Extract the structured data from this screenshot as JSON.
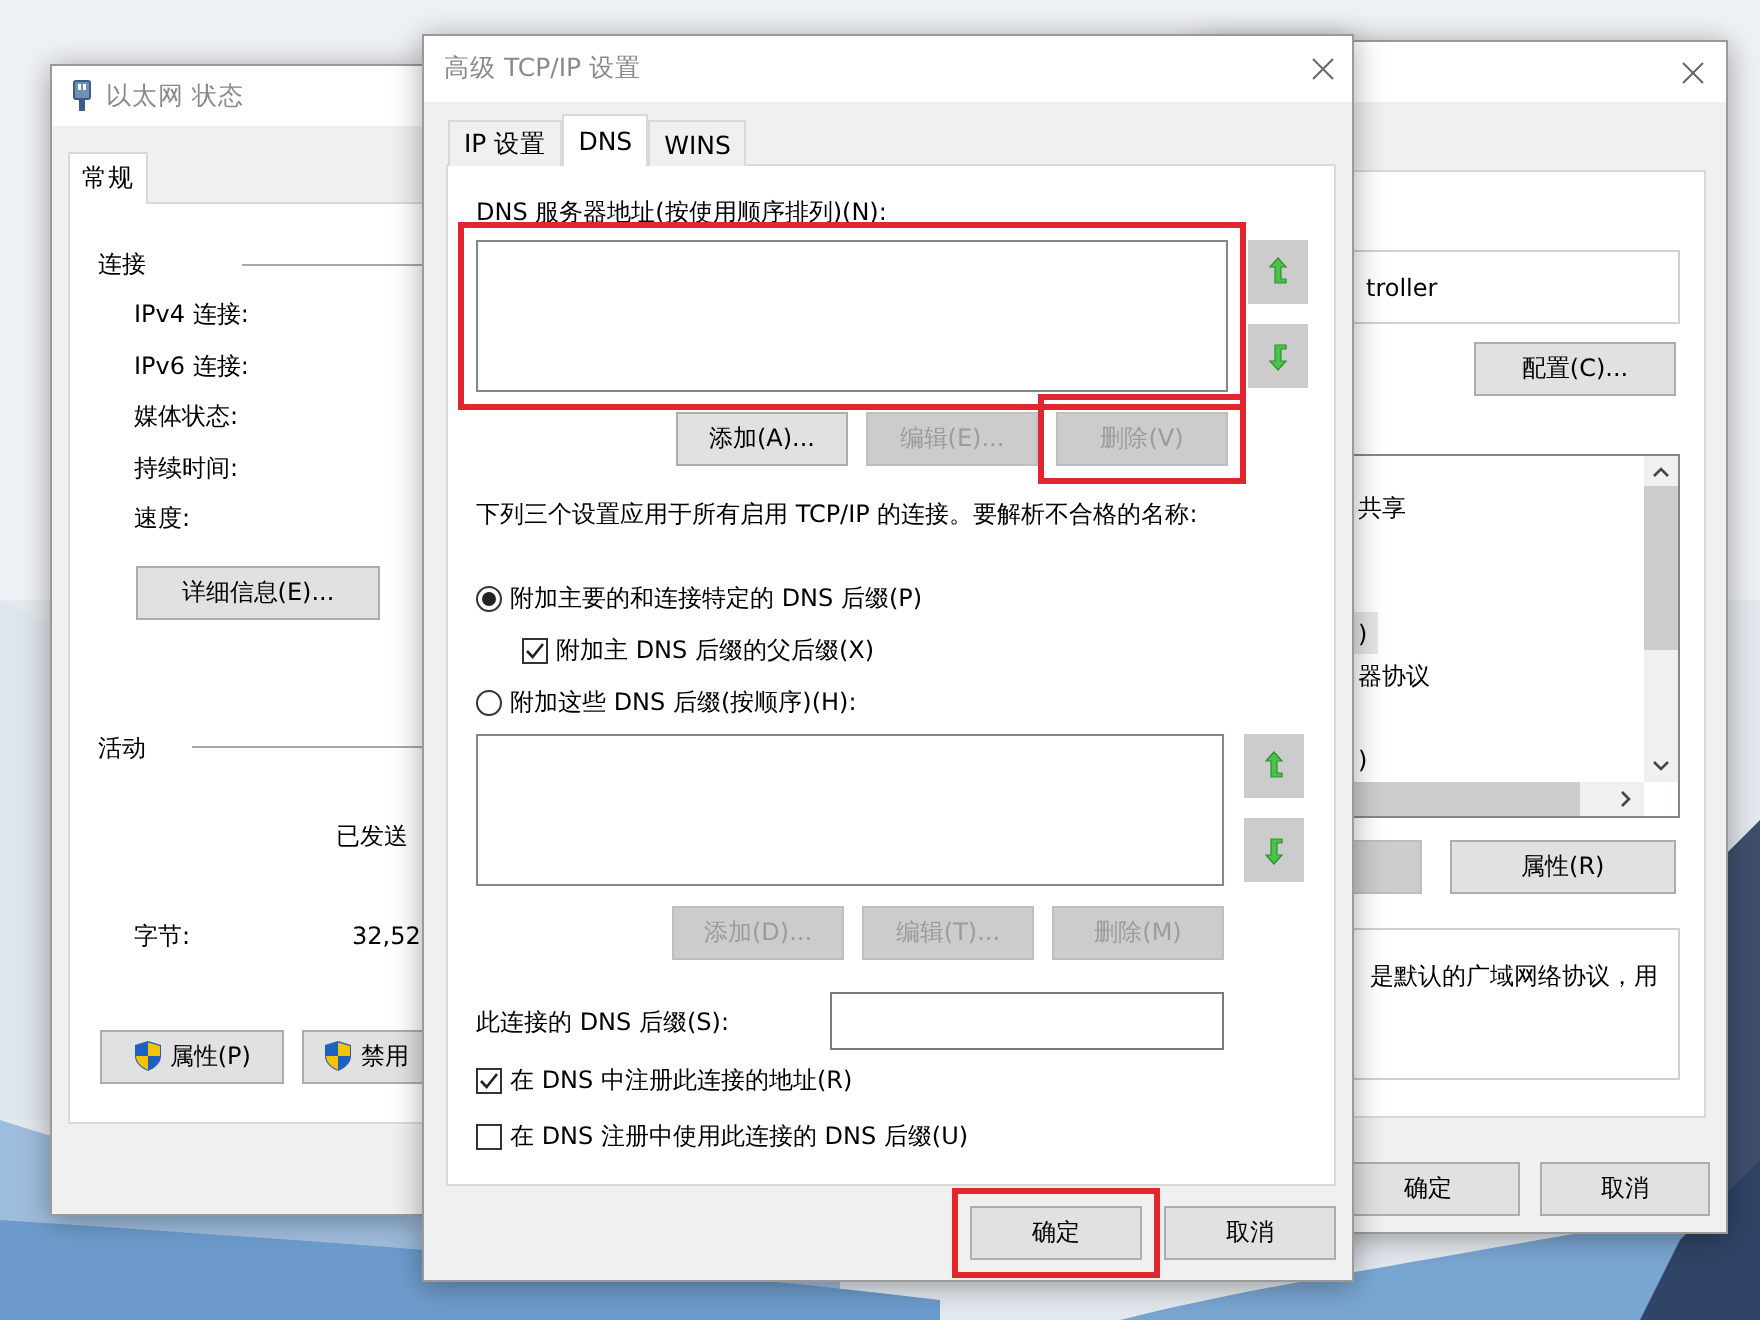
{
  "status_window": {
    "title": "以太网 状态",
    "tabs": [
      {
        "label": "常规",
        "selected": true
      }
    ],
    "connection": {
      "heading": "连接",
      "fields": [
        "IPv4 连接:",
        "IPv6 连接:",
        "媒体状态:",
        "持续时间:",
        "速度:"
      ],
      "details_button": "详细信息(E)..."
    },
    "activity": {
      "heading": "活动",
      "sent_heading": "已发送",
      "bytes_label": "字节:",
      "bytes_sent": "32,52"
    },
    "buttons": [
      {
        "label": "属性(P)"
      },
      {
        "label": "禁用"
      }
    ]
  },
  "tcpip_window": {
    "title": "高级 TCP/IP 设置",
    "tabs": [
      {
        "label": "IP 设置",
        "selected": false
      },
      {
        "label": "DNS",
        "selected": true
      },
      {
        "label": "WINS",
        "selected": false
      }
    ],
    "dns_servers": {
      "label": "DNS 服务器地址(按使用顺序排列)(N):",
      "highlighted": true,
      "buttons": [
        {
          "label": "添加(A)...",
          "disabled": false,
          "highlighted": false
        },
        {
          "label": "编辑(E)...",
          "disabled": true,
          "highlighted": false
        },
        {
          "label": "删除(V)",
          "disabled": true,
          "highlighted": true
        }
      ]
    },
    "note": "下列三个设置应用于所有启用 TCP/IP 的连接。要解析不合格的名称:",
    "suffix_options": [
      {
        "kind": "radio",
        "label": "附加主要的和连接特定的 DNS 后缀(P)",
        "selected": true,
        "children": [
          {
            "kind": "checkbox",
            "label": "附加主 DNS 后缀的父后缀(X)",
            "checked": true
          }
        ]
      },
      {
        "kind": "radio",
        "label": "附加这些 DNS 后缀(按顺序)(H):",
        "selected": false
      }
    ],
    "suffix_list": {
      "buttons": [
        {
          "label": "添加(D)...",
          "disabled": true
        },
        {
          "label": "编辑(T)...",
          "disabled": true
        },
        {
          "label": "删除(M)",
          "disabled": true
        }
      ]
    },
    "connection_suffix": {
      "label": "此连接的 DNS 后缀(S):"
    },
    "register_options": [
      {
        "label": "在 DNS 中注册此连接的地址(R)",
        "checked": true
      },
      {
        "label": "在 DNS 注册中使用此连接的 DNS 后缀(U)",
        "checked": false
      }
    ],
    "buttons": [
      {
        "label": "确定",
        "highlighted": true
      },
      {
        "label": "取消",
        "highlighted": false
      }
    ]
  },
  "properties_window": {
    "adapter_name": "troller",
    "configure_button": "配置(C)...",
    "items": [
      {
        "text": "共享",
        "selected": false
      },
      {
        "text": ")",
        "selected": true
      },
      {
        "text": "器协议",
        "selected": false
      },
      {
        "text": ")",
        "selected": false
      }
    ],
    "buttons": [
      {
        "disabled": true
      },
      {
        "label": "属性(R)",
        "disabled": false
      }
    ],
    "description": "是默认的广域网络协议，用",
    "footer_buttons": [
      {
        "label": "确定"
      },
      {
        "label": "取消"
      }
    ]
  }
}
